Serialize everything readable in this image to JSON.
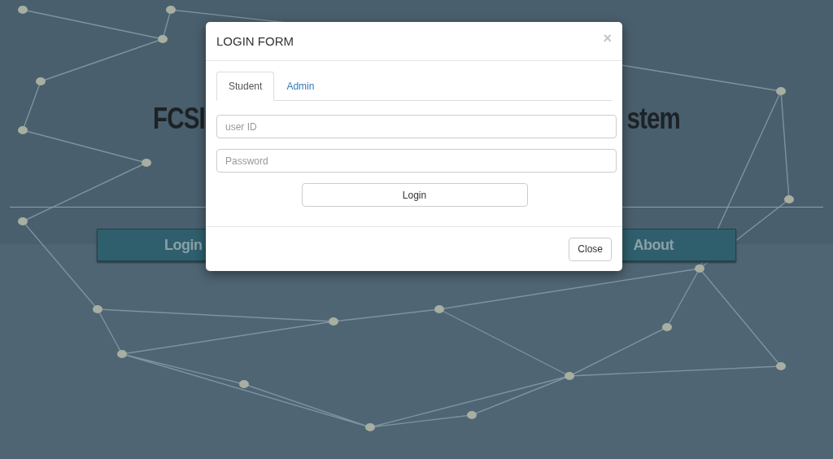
{
  "page": {
    "title_left": "FCSI",
    "title_right": "stem",
    "nav": [
      {
        "label": "Login"
      },
      {
        "label": "About"
      }
    ]
  },
  "modal": {
    "title": "LOGIN FORM",
    "close_icon": "×",
    "tabs": [
      {
        "label": "Student",
        "selected": true
      },
      {
        "label": "Admin",
        "selected": false
      }
    ],
    "fields": [
      {
        "placeholder": "user ID"
      },
      {
        "placeholder": "Password"
      }
    ],
    "submit": "Login",
    "footer_button": "Close"
  }
}
